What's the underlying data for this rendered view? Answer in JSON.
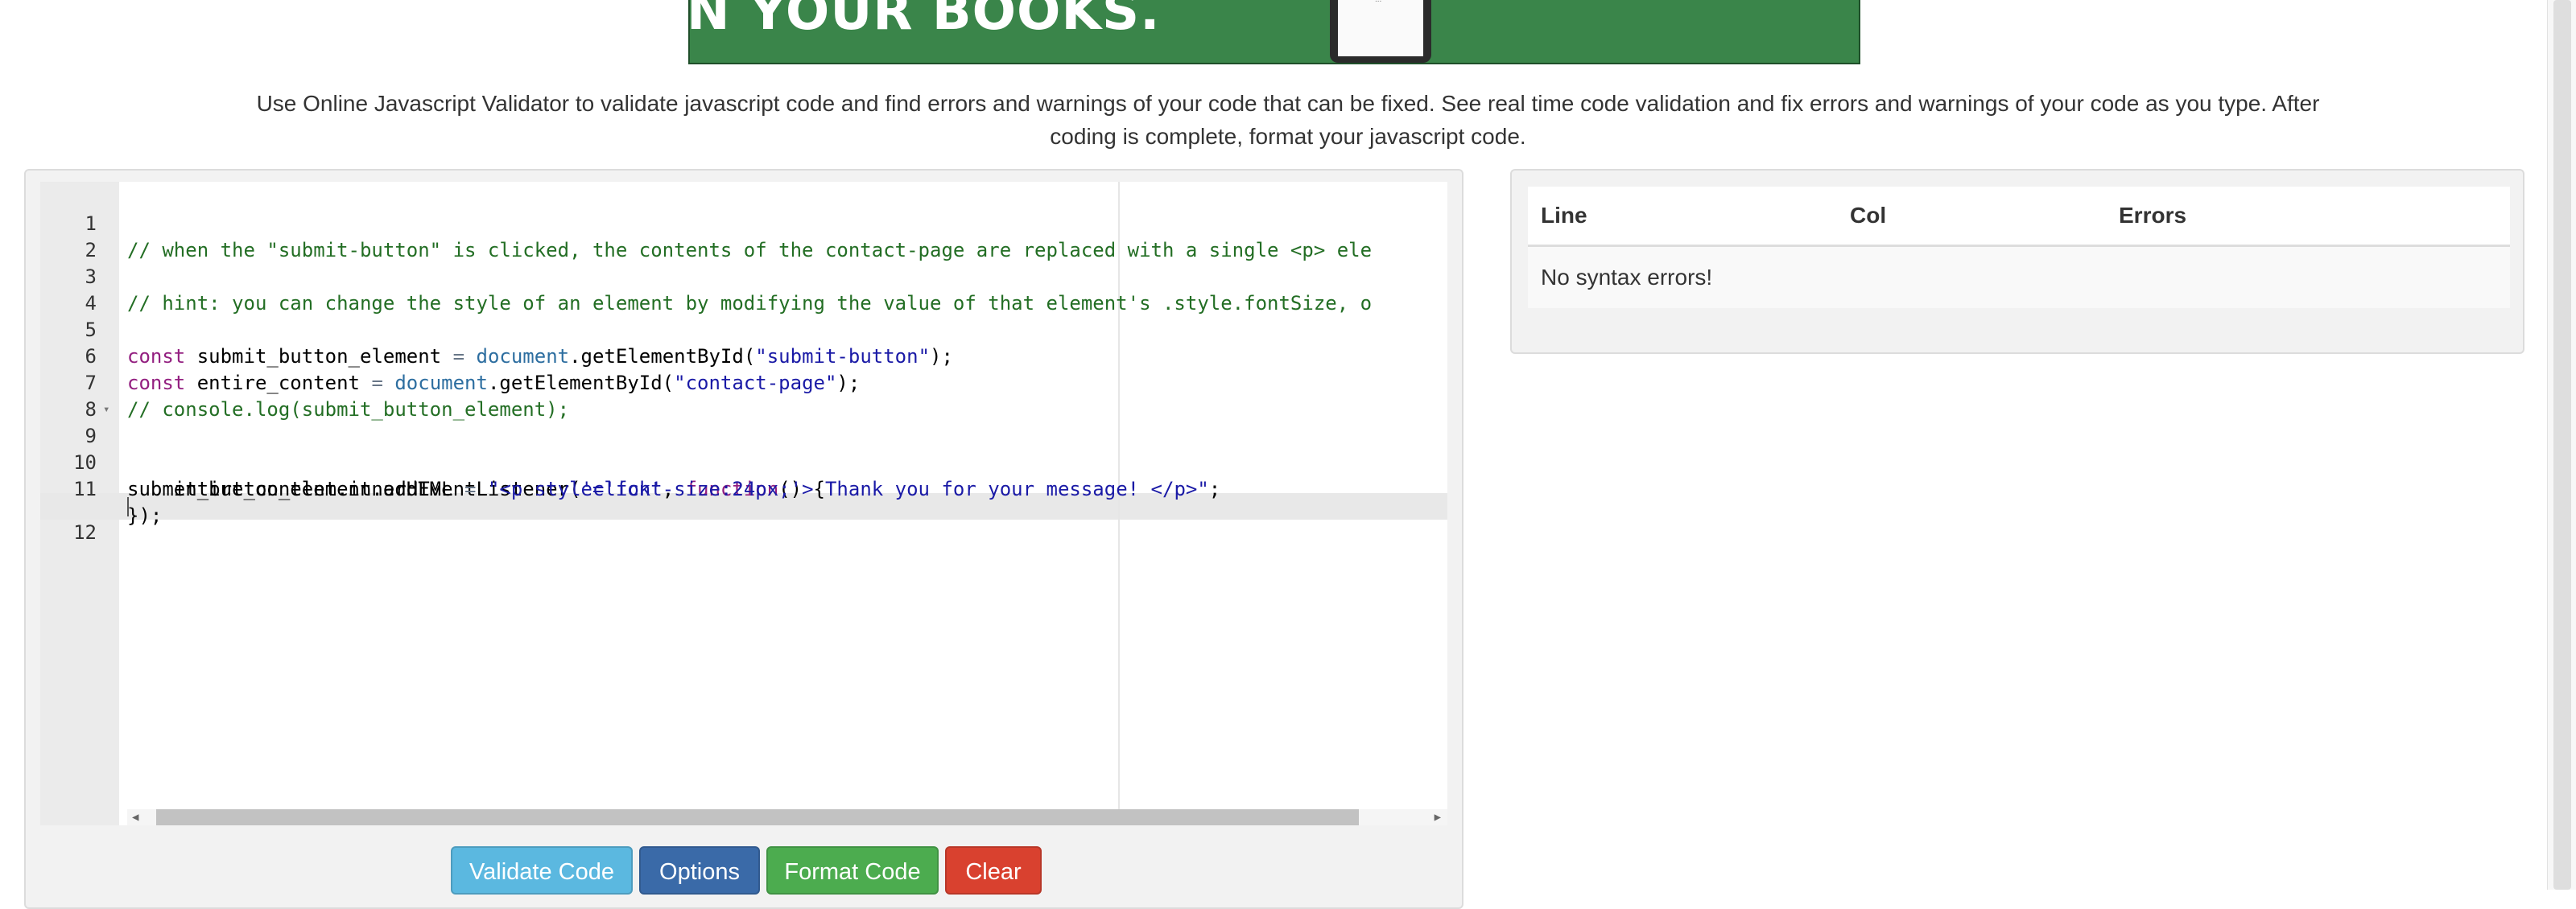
{
  "banner": {
    "text": "N YOUR BOOKS.",
    "phone_label": "..."
  },
  "description": "Use Online Javascript Validator to validate javascript code and find errors and warnings of your code that can be fixed. See real time code validation and fix errors and warnings of your code as you type. After coding is complete, format your javascript code.",
  "editor": {
    "line_numbers": [
      "1",
      "2",
      "3",
      "4",
      "5",
      "6",
      "7",
      "8",
      "9",
      "10",
      "11",
      "12"
    ],
    "lines": [
      "// when the \"submit-button\" is clicked, the contents of the contact-page are replaced with a single <p> ele",
      "",
      "// hint: you can change the style of an element by modifying the value of that element's .style.fontSize, o",
      "",
      "const submit_button_element = document.getElementById(\"submit-button\");",
      "const entire_content = document.getElementById(\"contact-page\");",
      "// console.log(submit_button_element);",
      "",
      "submit_button_element.addEventListener('click', function() {",
      "    entire_content.innerHTML = \"<p style='font-size:24px;'> Thank you for your message! </p>\";",
      "});",
      ""
    ],
    "tokens": {
      "l5": [
        "const",
        " submit_button_element ",
        "=",
        " ",
        "document",
        ".getElementById(",
        "\"submit-button\"",
        ");"
      ],
      "l6": [
        "const",
        " entire_content ",
        "=",
        " ",
        "document",
        ".getElementById(",
        "\"contact-page\"",
        ");"
      ],
      "l9": [
        "submit_button_element.addEventListener(",
        "'click'",
        ", ",
        "function",
        "() {"
      ],
      "l10": [
        "    entire_content.innerHTML ",
        "=",
        " ",
        "\"<p style='font-size:24px;'> Thank you for your message! </p>\"",
        ";"
      ]
    }
  },
  "buttons": {
    "validate": "Validate Code",
    "options": "Options",
    "format": "Format Code",
    "clear": "Clear"
  },
  "results": {
    "columns": [
      "Line",
      "Col",
      "Errors"
    ],
    "message": "No syntax errors!"
  },
  "colors": {
    "banner_green": "#3a854a",
    "validate": "#5bb8e0",
    "options": "#3a6aa8",
    "format": "#4cac4f",
    "clear": "#d9412f"
  }
}
